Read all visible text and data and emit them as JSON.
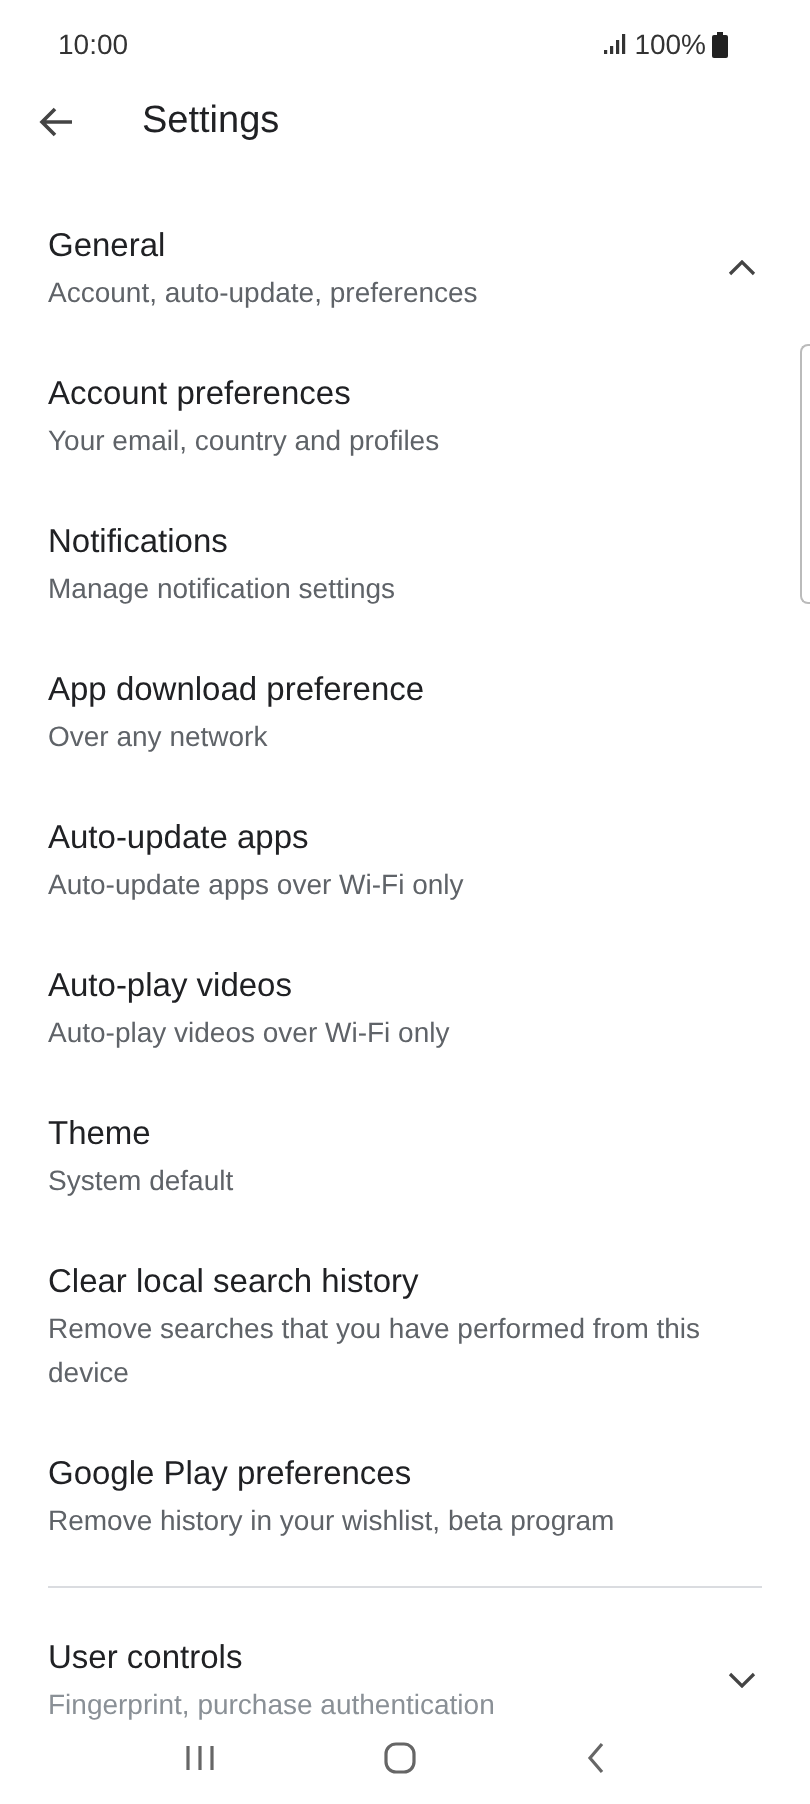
{
  "status_bar": {
    "time": "10:00",
    "battery": "100%"
  },
  "header": {
    "title": "Settings"
  },
  "sections": [
    {
      "title": "General",
      "subtitle": "Account, auto-update, preferences",
      "expanded": true,
      "items": [
        {
          "title": "Account preferences",
          "subtitle": "Your email, country and profiles"
        },
        {
          "title": "Notifications",
          "subtitle": "Manage notification settings"
        },
        {
          "title": "App download preference",
          "subtitle": "Over any network"
        },
        {
          "title": "Auto-update apps",
          "subtitle": "Auto-update apps over Wi-Fi only"
        },
        {
          "title": "Auto-play videos",
          "subtitle": "Auto-play videos over Wi-Fi only"
        },
        {
          "title": "Theme",
          "subtitle": "System default"
        },
        {
          "title": "Clear local search history",
          "subtitle": "Remove searches that you have performed from this device"
        },
        {
          "title": "Google Play preferences",
          "subtitle": "Remove history in your wishlist, beta program"
        }
      ]
    },
    {
      "title": "User controls",
      "subtitle": "Fingerprint, purchase authentication",
      "expanded": false
    }
  ]
}
